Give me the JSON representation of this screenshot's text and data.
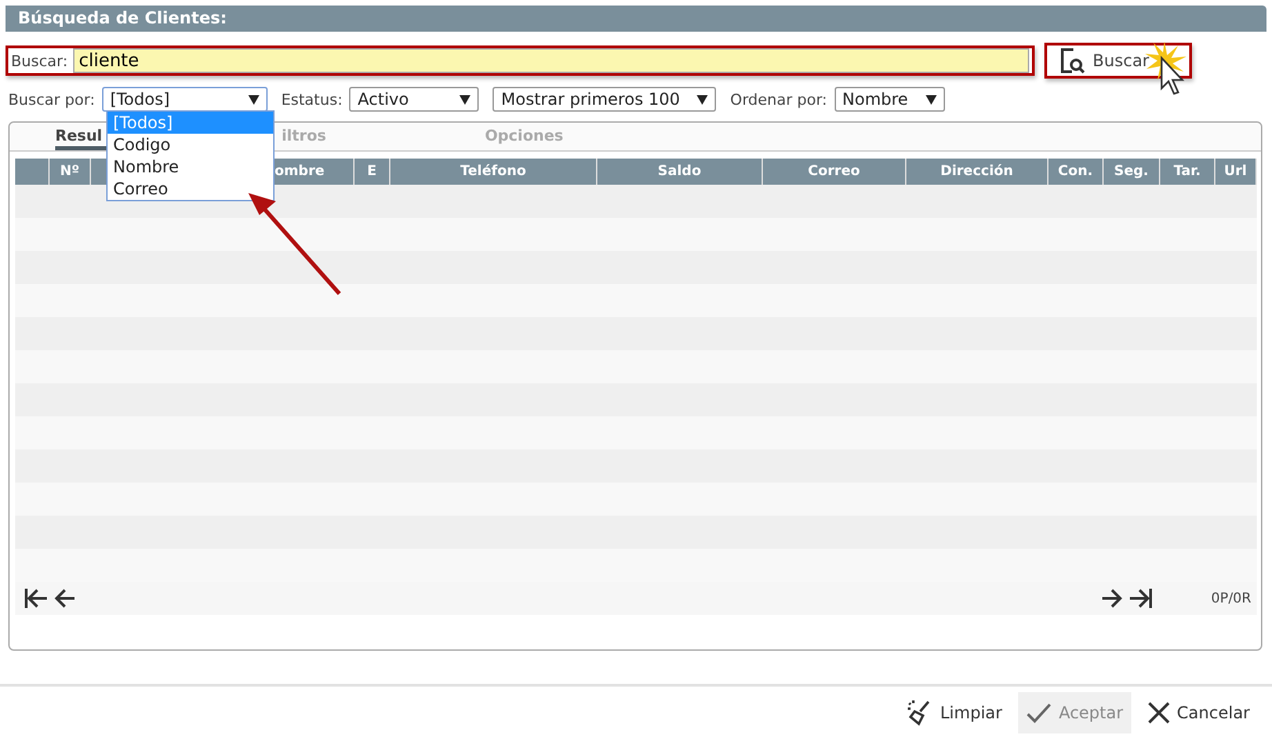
{
  "title": "Búsqueda de Clientes:",
  "search": {
    "label": "Buscar:",
    "value": "cliente",
    "button": "Buscar"
  },
  "filters": [
    {
      "label": "Buscar por:",
      "value": "[Todos]"
    },
    {
      "label": "Estatus:",
      "value": "Activo"
    },
    {
      "value": "Mostrar primeros 100"
    },
    {
      "label": "Ordenar por:",
      "value": "Nombre"
    }
  ],
  "dropdown": {
    "options": [
      {
        "label": "[Todos]",
        "selected": true
      },
      {
        "label": "Codigo",
        "selected": false
      },
      {
        "label": "Nombre",
        "selected": false
      },
      {
        "label": "Correo",
        "selected": false
      }
    ]
  },
  "tabs": [
    {
      "label": "Resul",
      "selected": true
    },
    {
      "label": "iltros",
      "selected": false
    },
    {
      "label": "Opciones",
      "selected": false
    }
  ],
  "table": {
    "columns": [
      {},
      {
        "label": "Nº"
      },
      {},
      {
        "label": "ombre"
      },
      {
        "label": "E"
      },
      {
        "label": "Teléfono"
      },
      {
        "label": "Saldo"
      },
      {
        "label": "Correo"
      },
      {
        "label": "Dirección"
      },
      {
        "label": "Con."
      },
      {
        "label": "Seg."
      },
      {
        "label": "Tar."
      },
      {
        "label": "Url"
      }
    ]
  },
  "pager": {
    "count": "0P/0R"
  },
  "buttons": [
    {
      "kind": "clear",
      "label": "Limpiar",
      "disabled": false
    },
    {
      "kind": "accept",
      "label": "Aceptar",
      "disabled": true
    },
    {
      "kind": "cancel",
      "label": "Cancelar",
      "disabled": false
    }
  ]
}
